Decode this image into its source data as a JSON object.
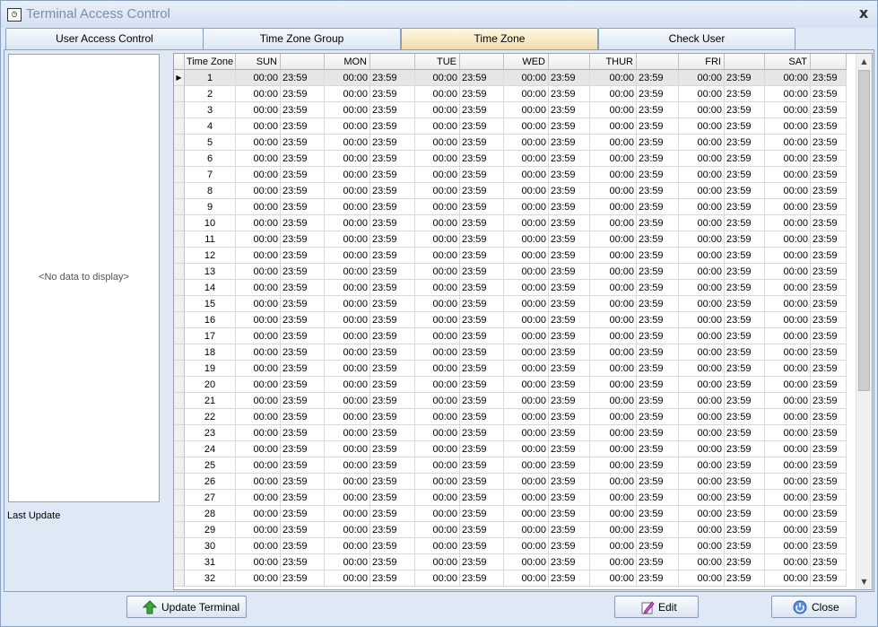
{
  "window": {
    "title": "Terminal Access Control",
    "close_glyph": "x",
    "icon": "clock-window-icon"
  },
  "tabs": [
    {
      "label": "User Access Control",
      "active": false
    },
    {
      "label": "Time Zone Group",
      "active": false
    },
    {
      "label": "Time Zone",
      "active": true
    },
    {
      "label": "Check User",
      "active": false
    }
  ],
  "left_panel": {
    "empty_text": "<No data to display>",
    "last_update_label": "Last Update"
  },
  "grid": {
    "headers": [
      "Time Zone",
      "SUN",
      "MON",
      "TUE",
      "WED",
      "THUR",
      "FRI",
      "SAT"
    ],
    "selected_row": 1,
    "rows": [
      {
        "tz": "1",
        "times": [
          "00:00",
          "23:59",
          "00:00",
          "23:59",
          "00:00",
          "23:59",
          "00:00",
          "23:59",
          "00:00",
          "23:59",
          "00:00",
          "23:59",
          "00:00",
          "23:59"
        ]
      },
      {
        "tz": "2",
        "times": [
          "00:00",
          "23:59",
          "00:00",
          "23:59",
          "00:00",
          "23:59",
          "00:00",
          "23:59",
          "00:00",
          "23:59",
          "00:00",
          "23:59",
          "00:00",
          "23:59"
        ]
      },
      {
        "tz": "3",
        "times": [
          "00:00",
          "23:59",
          "00:00",
          "23:59",
          "00:00",
          "23:59",
          "00:00",
          "23:59",
          "00:00",
          "23:59",
          "00:00",
          "23:59",
          "00:00",
          "23:59"
        ]
      },
      {
        "tz": "4",
        "times": [
          "00:00",
          "23:59",
          "00:00",
          "23:59",
          "00:00",
          "23:59",
          "00:00",
          "23:59",
          "00:00",
          "23:59",
          "00:00",
          "23:59",
          "00:00",
          "23:59"
        ]
      },
      {
        "tz": "5",
        "times": [
          "00:00",
          "23:59",
          "00:00",
          "23:59",
          "00:00",
          "23:59",
          "00:00",
          "23:59",
          "00:00",
          "23:59",
          "00:00",
          "23:59",
          "00:00",
          "23:59"
        ]
      },
      {
        "tz": "6",
        "times": [
          "00:00",
          "23:59",
          "00:00",
          "23:59",
          "00:00",
          "23:59",
          "00:00",
          "23:59",
          "00:00",
          "23:59",
          "00:00",
          "23:59",
          "00:00",
          "23:59"
        ]
      },
      {
        "tz": "7",
        "times": [
          "00:00",
          "23:59",
          "00:00",
          "23:59",
          "00:00",
          "23:59",
          "00:00",
          "23:59",
          "00:00",
          "23:59",
          "00:00",
          "23:59",
          "00:00",
          "23:59"
        ]
      },
      {
        "tz": "8",
        "times": [
          "00:00",
          "23:59",
          "00:00",
          "23:59",
          "00:00",
          "23:59",
          "00:00",
          "23:59",
          "00:00",
          "23:59",
          "00:00",
          "23:59",
          "00:00",
          "23:59"
        ]
      },
      {
        "tz": "9",
        "times": [
          "00:00",
          "23:59",
          "00:00",
          "23:59",
          "00:00",
          "23:59",
          "00:00",
          "23:59",
          "00:00",
          "23:59",
          "00:00",
          "23:59",
          "00:00",
          "23:59"
        ]
      },
      {
        "tz": "10",
        "times": [
          "00:00",
          "23:59",
          "00:00",
          "23:59",
          "00:00",
          "23:59",
          "00:00",
          "23:59",
          "00:00",
          "23:59",
          "00:00",
          "23:59",
          "00:00",
          "23:59"
        ]
      },
      {
        "tz": "11",
        "times": [
          "00:00",
          "23:59",
          "00:00",
          "23:59",
          "00:00",
          "23:59",
          "00:00",
          "23:59",
          "00:00",
          "23:59",
          "00:00",
          "23:59",
          "00:00",
          "23:59"
        ]
      },
      {
        "tz": "12",
        "times": [
          "00:00",
          "23:59",
          "00:00",
          "23:59",
          "00:00",
          "23:59",
          "00:00",
          "23:59",
          "00:00",
          "23:59",
          "00:00",
          "23:59",
          "00:00",
          "23:59"
        ]
      },
      {
        "tz": "13",
        "times": [
          "00:00",
          "23:59",
          "00:00",
          "23:59",
          "00:00",
          "23:59",
          "00:00",
          "23:59",
          "00:00",
          "23:59",
          "00:00",
          "23:59",
          "00:00",
          "23:59"
        ]
      },
      {
        "tz": "14",
        "times": [
          "00:00",
          "23:59",
          "00:00",
          "23:59",
          "00:00",
          "23:59",
          "00:00",
          "23:59",
          "00:00",
          "23:59",
          "00:00",
          "23:59",
          "00:00",
          "23:59"
        ]
      },
      {
        "tz": "15",
        "times": [
          "00:00",
          "23:59",
          "00:00",
          "23:59",
          "00:00",
          "23:59",
          "00:00",
          "23:59",
          "00:00",
          "23:59",
          "00:00",
          "23:59",
          "00:00",
          "23:59"
        ]
      },
      {
        "tz": "16",
        "times": [
          "00:00",
          "23:59",
          "00:00",
          "23:59",
          "00:00",
          "23:59",
          "00:00",
          "23:59",
          "00:00",
          "23:59",
          "00:00",
          "23:59",
          "00:00",
          "23:59"
        ]
      },
      {
        "tz": "17",
        "times": [
          "00:00",
          "23:59",
          "00:00",
          "23:59",
          "00:00",
          "23:59",
          "00:00",
          "23:59",
          "00:00",
          "23:59",
          "00:00",
          "23:59",
          "00:00",
          "23:59"
        ]
      },
      {
        "tz": "18",
        "times": [
          "00:00",
          "23:59",
          "00:00",
          "23:59",
          "00:00",
          "23:59",
          "00:00",
          "23:59",
          "00:00",
          "23:59",
          "00:00",
          "23:59",
          "00:00",
          "23:59"
        ]
      },
      {
        "tz": "19",
        "times": [
          "00:00",
          "23:59",
          "00:00",
          "23:59",
          "00:00",
          "23:59",
          "00:00",
          "23:59",
          "00:00",
          "23:59",
          "00:00",
          "23:59",
          "00:00",
          "23:59"
        ]
      },
      {
        "tz": "20",
        "times": [
          "00:00",
          "23:59",
          "00:00",
          "23:59",
          "00:00",
          "23:59",
          "00:00",
          "23:59",
          "00:00",
          "23:59",
          "00:00",
          "23:59",
          "00:00",
          "23:59"
        ]
      },
      {
        "tz": "21",
        "times": [
          "00:00",
          "23:59",
          "00:00",
          "23:59",
          "00:00",
          "23:59",
          "00:00",
          "23:59",
          "00:00",
          "23:59",
          "00:00",
          "23:59",
          "00:00",
          "23:59"
        ]
      },
      {
        "tz": "22",
        "times": [
          "00:00",
          "23:59",
          "00:00",
          "23:59",
          "00:00",
          "23:59",
          "00:00",
          "23:59",
          "00:00",
          "23:59",
          "00:00",
          "23:59",
          "00:00",
          "23:59"
        ]
      },
      {
        "tz": "23",
        "times": [
          "00:00",
          "23:59",
          "00:00",
          "23:59",
          "00:00",
          "23:59",
          "00:00",
          "23:59",
          "00:00",
          "23:59",
          "00:00",
          "23:59",
          "00:00",
          "23:59"
        ]
      },
      {
        "tz": "24",
        "times": [
          "00:00",
          "23:59",
          "00:00",
          "23:59",
          "00:00",
          "23:59",
          "00:00",
          "23:59",
          "00:00",
          "23:59",
          "00:00",
          "23:59",
          "00:00",
          "23:59"
        ]
      },
      {
        "tz": "25",
        "times": [
          "00:00",
          "23:59",
          "00:00",
          "23:59",
          "00:00",
          "23:59",
          "00:00",
          "23:59",
          "00:00",
          "23:59",
          "00:00",
          "23:59",
          "00:00",
          "23:59"
        ]
      },
      {
        "tz": "26",
        "times": [
          "00:00",
          "23:59",
          "00:00",
          "23:59",
          "00:00",
          "23:59",
          "00:00",
          "23:59",
          "00:00",
          "23:59",
          "00:00",
          "23:59",
          "00:00",
          "23:59"
        ]
      },
      {
        "tz": "27",
        "times": [
          "00:00",
          "23:59",
          "00:00",
          "23:59",
          "00:00",
          "23:59",
          "00:00",
          "23:59",
          "00:00",
          "23:59",
          "00:00",
          "23:59",
          "00:00",
          "23:59"
        ]
      },
      {
        "tz": "28",
        "times": [
          "00:00",
          "23:59",
          "00:00",
          "23:59",
          "00:00",
          "23:59",
          "00:00",
          "23:59",
          "00:00",
          "23:59",
          "00:00",
          "23:59",
          "00:00",
          "23:59"
        ]
      },
      {
        "tz": "29",
        "times": [
          "00:00",
          "23:59",
          "00:00",
          "23:59",
          "00:00",
          "23:59",
          "00:00",
          "23:59",
          "00:00",
          "23:59",
          "00:00",
          "23:59",
          "00:00",
          "23:59"
        ]
      },
      {
        "tz": "30",
        "times": [
          "00:00",
          "23:59",
          "00:00",
          "23:59",
          "00:00",
          "23:59",
          "00:00",
          "23:59",
          "00:00",
          "23:59",
          "00:00",
          "23:59",
          "00:00",
          "23:59"
        ]
      },
      {
        "tz": "31",
        "times": [
          "00:00",
          "23:59",
          "00:00",
          "23:59",
          "00:00",
          "23:59",
          "00:00",
          "23:59",
          "00:00",
          "23:59",
          "00:00",
          "23:59",
          "00:00",
          "23:59"
        ]
      },
      {
        "tz": "32",
        "times": [
          "00:00",
          "23:59",
          "00:00",
          "23:59",
          "00:00",
          "23:59",
          "00:00",
          "23:59",
          "00:00",
          "23:59",
          "00:00",
          "23:59",
          "00:00",
          "23:59"
        ]
      }
    ]
  },
  "buttons": {
    "update_terminal": {
      "label": "Update Terminal",
      "icon": "green-up-arrow-icon"
    },
    "edit": {
      "label": "Edit",
      "icon": "edit-pencil-icon"
    },
    "close": {
      "label": "Close",
      "icon": "close-circle-icon"
    }
  },
  "colors": {
    "title_text": "#7d8ea6",
    "active_tab": "#f0ddb0",
    "selected_row": "#e6e6e6",
    "accent_green": "#3aa63a"
  }
}
